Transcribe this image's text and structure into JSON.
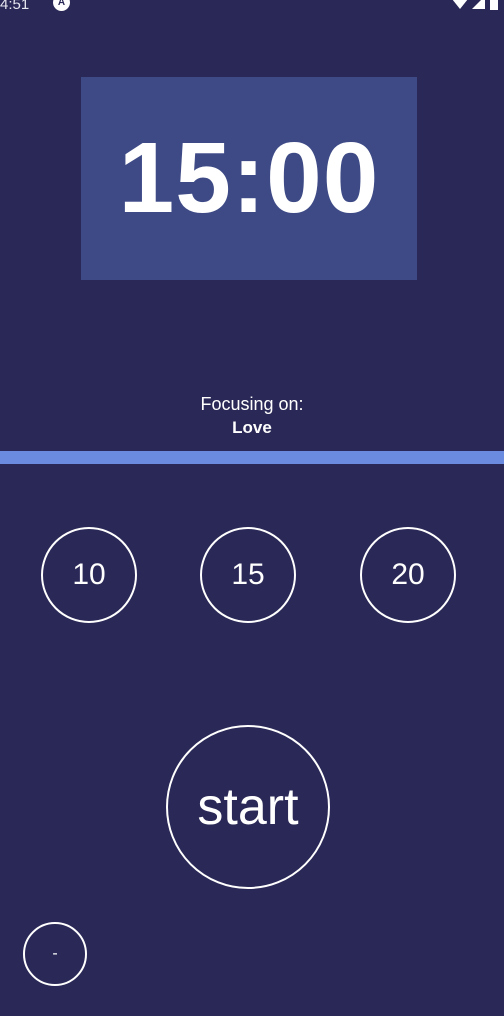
{
  "status_bar": {
    "time": "4:51",
    "app_icon": "A"
  },
  "timer": {
    "display": "15:00"
  },
  "focus": {
    "label": "Focusing on:",
    "subject": "Love"
  },
  "progress": {
    "fraction": 1.0
  },
  "presets": [
    {
      "label": "10"
    },
    {
      "label": "15"
    },
    {
      "label": "20"
    }
  ],
  "start_button": {
    "label": "start"
  },
  "minus_button": {
    "label": "-"
  },
  "colors": {
    "background": "#2a2856",
    "timer_box": "#3d4a86",
    "progress_fill": "#6a8be0",
    "foreground": "#ffffff"
  }
}
